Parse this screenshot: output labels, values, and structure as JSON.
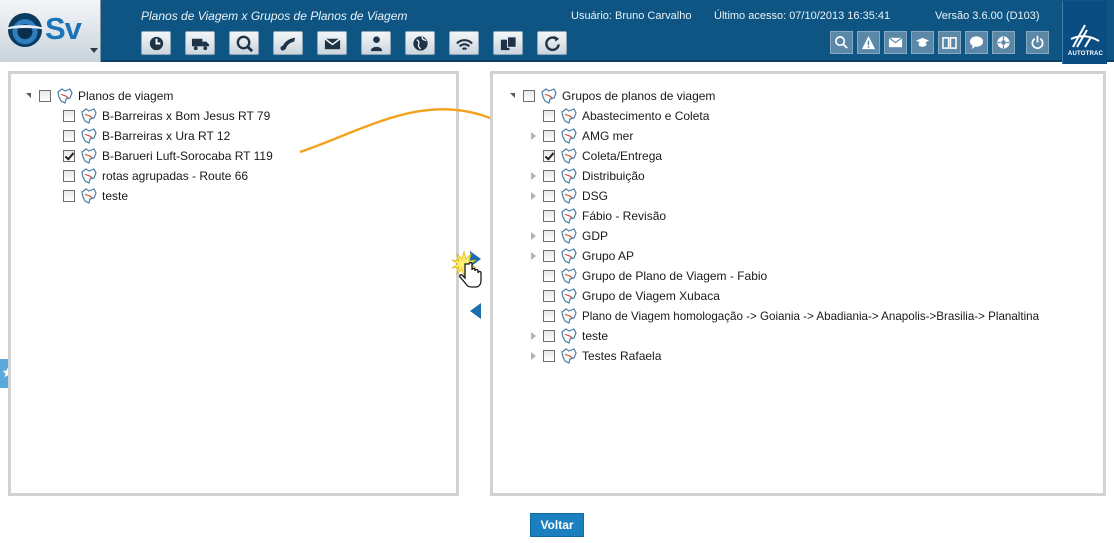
{
  "app": {
    "logo_text": "Sv",
    "page_title": "Planos de Viagem x Grupos de Planos de Viagem",
    "user_label": "Usuário: Bruno Carvalho",
    "last_access_label": "Último acesso: 07/10/2013 16:35:41",
    "version_label": "Versão 3.6.00 (D103)",
    "brand_label": "AUTOTRAC"
  },
  "toolbar": {
    "icons": [
      "clock-icon",
      "truck-icon",
      "globe-search-icon",
      "route-icon",
      "mail-icon",
      "person-icon",
      "world-icon",
      "signal-icon",
      "documents-icon",
      "refresh-icon"
    ]
  },
  "right_toolbar": {
    "icons": [
      "search-icon",
      "warning-icon",
      "messages-icon",
      "training-icon",
      "manual-icon",
      "chat-icon",
      "settings-icon",
      "power-icon"
    ]
  },
  "left_tree": {
    "root_label": "Planos de viagem",
    "items": [
      {
        "label": "B-Barreiras x Bom Jesus RT 79",
        "checked": false
      },
      {
        "label": "B-Barreiras x Ura RT 12",
        "checked": false
      },
      {
        "label": "B-Barueri Luft-Sorocaba RT 119",
        "checked": true
      },
      {
        "label": "rotas agrupadas - Route 66",
        "checked": false
      },
      {
        "label": "teste",
        "checked": false
      }
    ]
  },
  "right_tree": {
    "root_label": "Grupos de planos de viagem",
    "items": [
      {
        "label": "Abastecimento e Coleta",
        "checked": false,
        "expandable": false
      },
      {
        "label": "AMG mer",
        "checked": false,
        "expandable": true
      },
      {
        "label": "Coleta/Entrega",
        "checked": true,
        "expandable": false
      },
      {
        "label": "Distribuição",
        "checked": false,
        "expandable": true
      },
      {
        "label": "DSG",
        "checked": false,
        "expandable": true
      },
      {
        "label": "Fábio - Revisão",
        "checked": false,
        "expandable": false
      },
      {
        "label": "GDP",
        "checked": false,
        "expandable": true
      },
      {
        "label": "Grupo AP",
        "checked": false,
        "expandable": true
      },
      {
        "label": "Grupo de Plano de Viagem - Fabio",
        "checked": false,
        "expandable": false
      },
      {
        "label": "Grupo de Viagem Xubaca",
        "checked": false,
        "expandable": false
      },
      {
        "label": "Plano de Viagem homologação -> Goiania -> Abadiania-> Anapolis->Brasilia-> Planaltina",
        "checked": false,
        "expandable": false
      },
      {
        "label": "teste",
        "checked": false,
        "expandable": true
      },
      {
        "label": "Testes Rafaela",
        "checked": false,
        "expandable": true
      }
    ]
  },
  "actions": {
    "back_label": "Voltar"
  },
  "colors": {
    "header_bg": "#0e5583",
    "accent": "#1b80bf",
    "annotation_arrow": "#f3a21c"
  }
}
